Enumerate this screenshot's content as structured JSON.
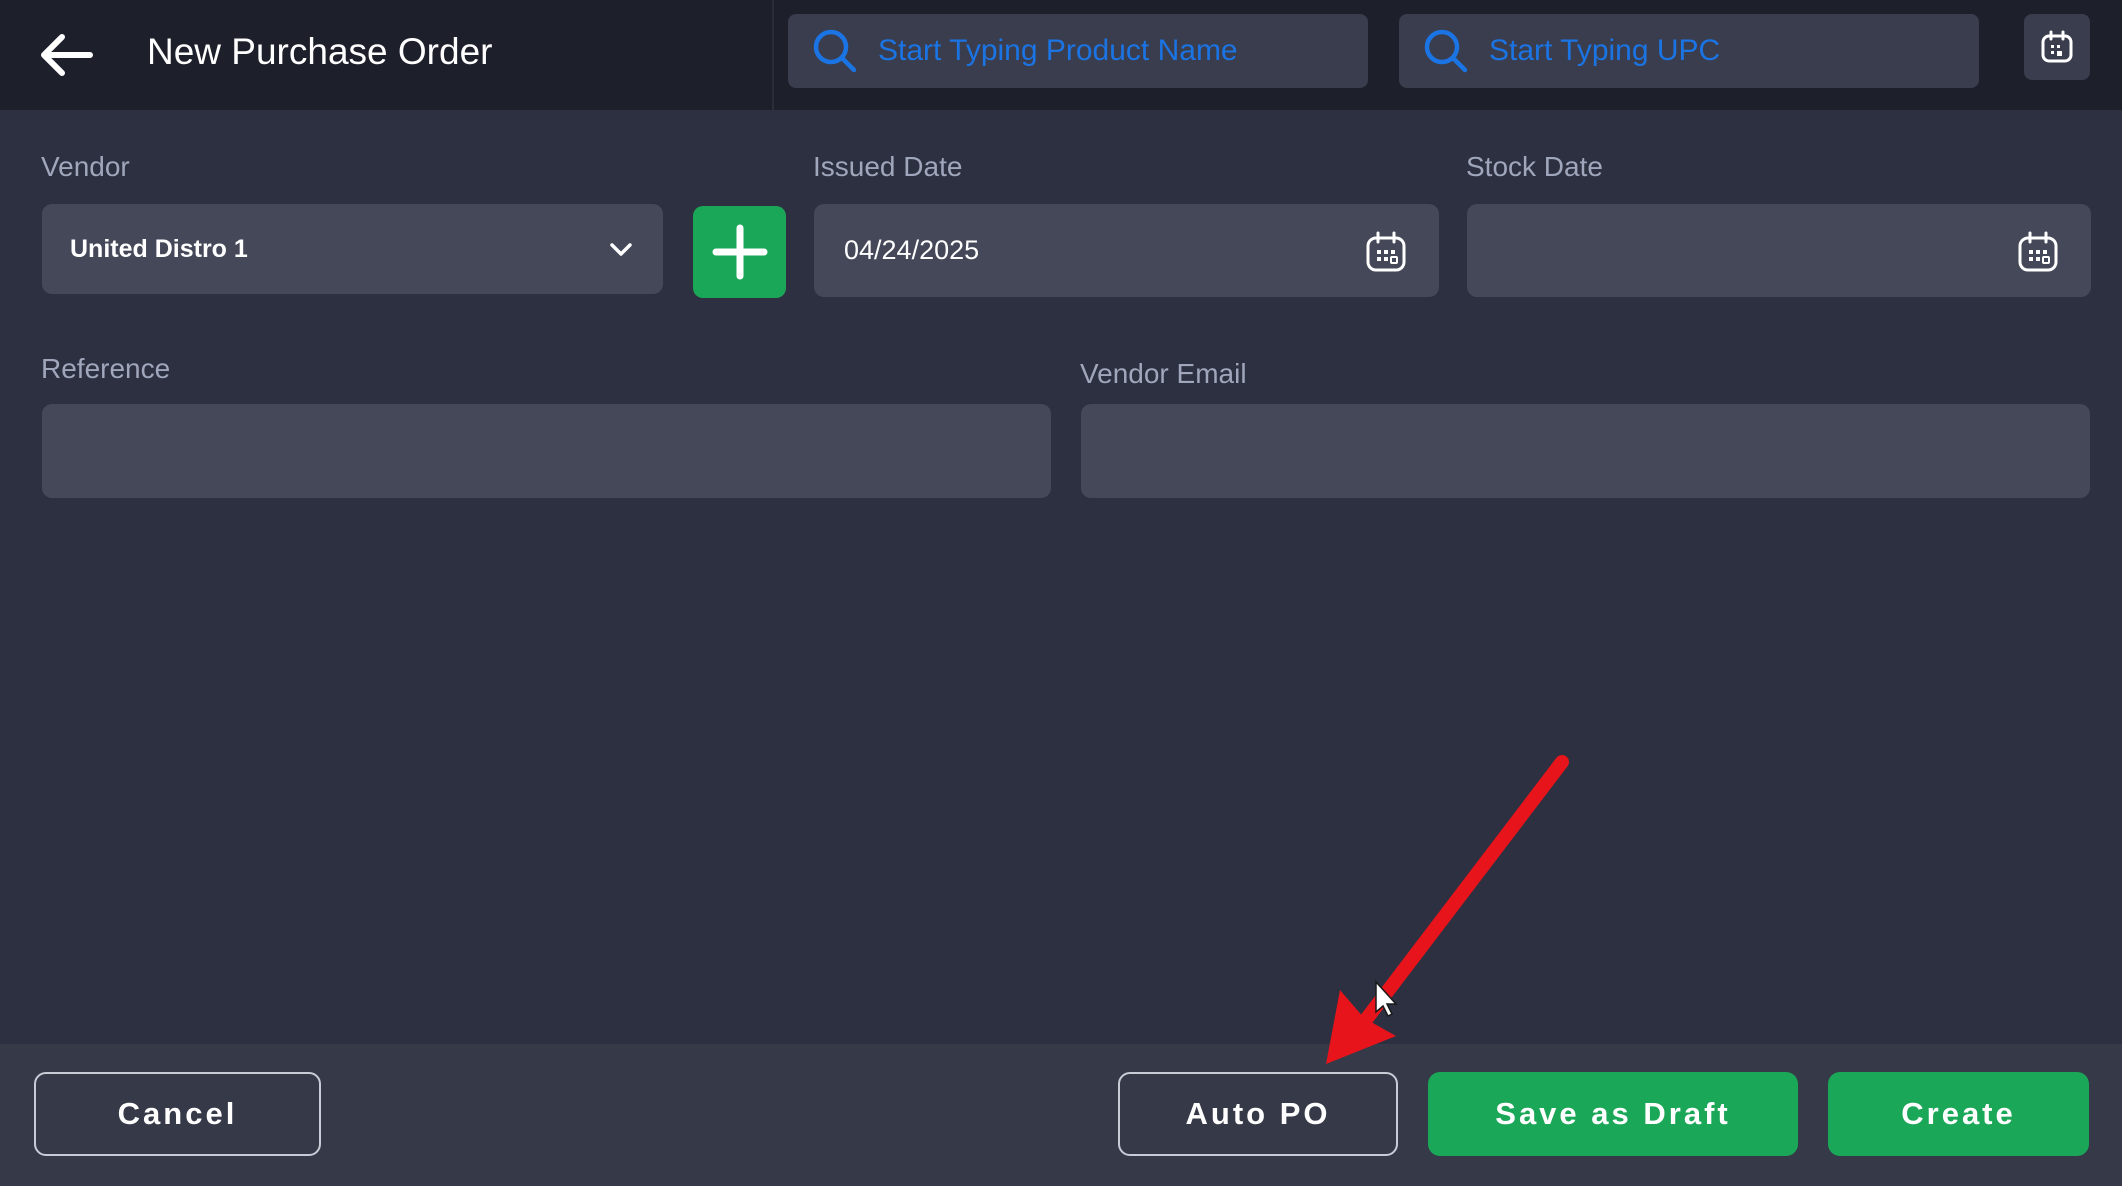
{
  "header": {
    "title": "New Purchase Order",
    "search_product_placeholder": "Start Typing Product Name",
    "search_upc_placeholder": "Start Typing UPC"
  },
  "form": {
    "vendor_label": "Vendor",
    "vendor_value": "United Distro 1",
    "issued_date_label": "Issued Date",
    "issued_date_value": "04/24/2025",
    "stock_date_label": "Stock Date",
    "stock_date_value": "",
    "reference_label": "Reference",
    "reference_value": "",
    "vendor_email_label": "Vendor Email",
    "vendor_email_value": ""
  },
  "footer": {
    "cancel_label": "Cancel",
    "auto_po_label": "Auto PO",
    "save_draft_label": "Save as Draft",
    "create_label": "Create"
  },
  "colors": {
    "background": "#2d3040",
    "header": "#1d1f2b",
    "field": "#444859",
    "accent_green": "#1ba758",
    "search_blue": "#1b74e4",
    "annotation_red": "#e8141b"
  }
}
